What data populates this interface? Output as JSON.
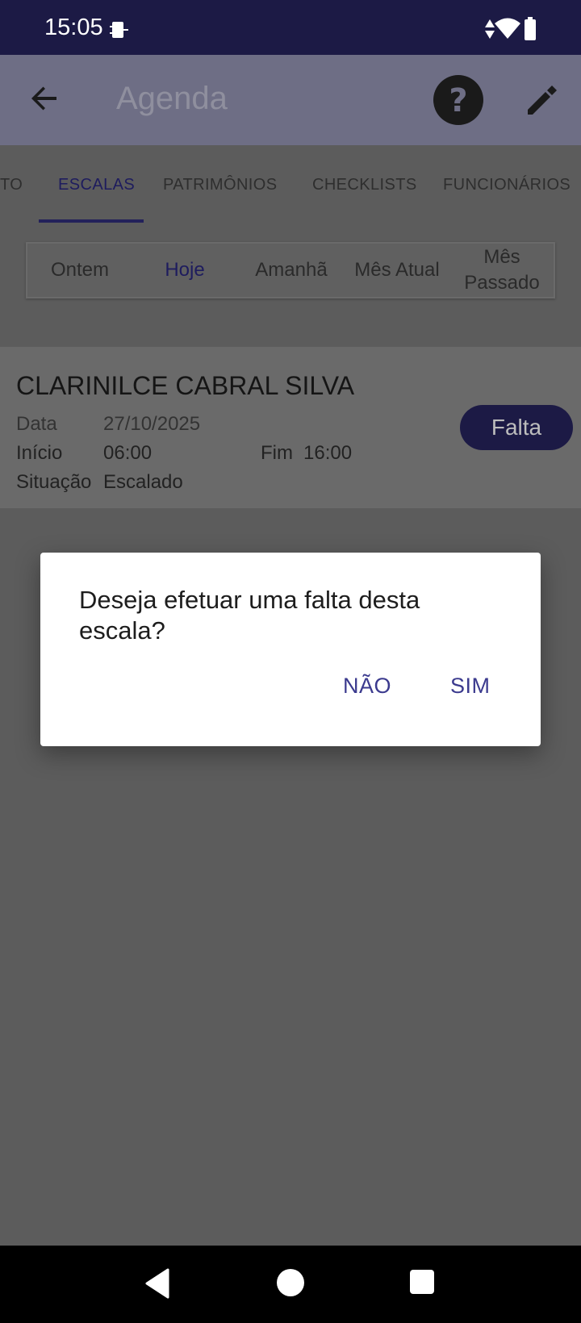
{
  "status_bar": {
    "time": "15:05",
    "icons": [
      "device-icon",
      "data-arrows-icon",
      "wifi-icon",
      "battery-icon"
    ]
  },
  "app_bar": {
    "title": "Agenda",
    "back_icon": "arrow-left-icon",
    "help_icon": "help-circle-icon",
    "edit_icon": "pencil-icon"
  },
  "tabs": {
    "items": [
      "TO",
      "ESCALAS",
      "PATRIMÔNIOS",
      "CHECKLISTS",
      "FUNCIONÁRIOS"
    ],
    "active": "ESCALAS"
  },
  "filter": {
    "items": [
      "Ontem",
      "Hoje",
      "Amanhã",
      "Mês Atual",
      "Mês Passado"
    ],
    "active": "Hoje"
  },
  "card": {
    "name": "CLARINILCE CABRAL SILVA",
    "data_label": "Data",
    "data_value": "27/10/2025",
    "inicio_label": "Início",
    "inicio_value": "06:00",
    "fim_label": "Fim",
    "fim_value": "16:00",
    "situacao_label": "Situação",
    "situacao_value": "Escalado",
    "falta_button": "Falta"
  },
  "dialog": {
    "message": "Deseja efetuar uma falta desta escala?",
    "no_button": "NÃO",
    "yes_button": "SIM"
  },
  "nav_bar": {
    "icons": [
      "back-triangle-icon",
      "home-circle-icon",
      "recents-square-icon"
    ]
  },
  "colors": {
    "primary_dark": "#1c1a45",
    "accent": "#3b3a8e",
    "scrim": "#5c5c5c"
  }
}
